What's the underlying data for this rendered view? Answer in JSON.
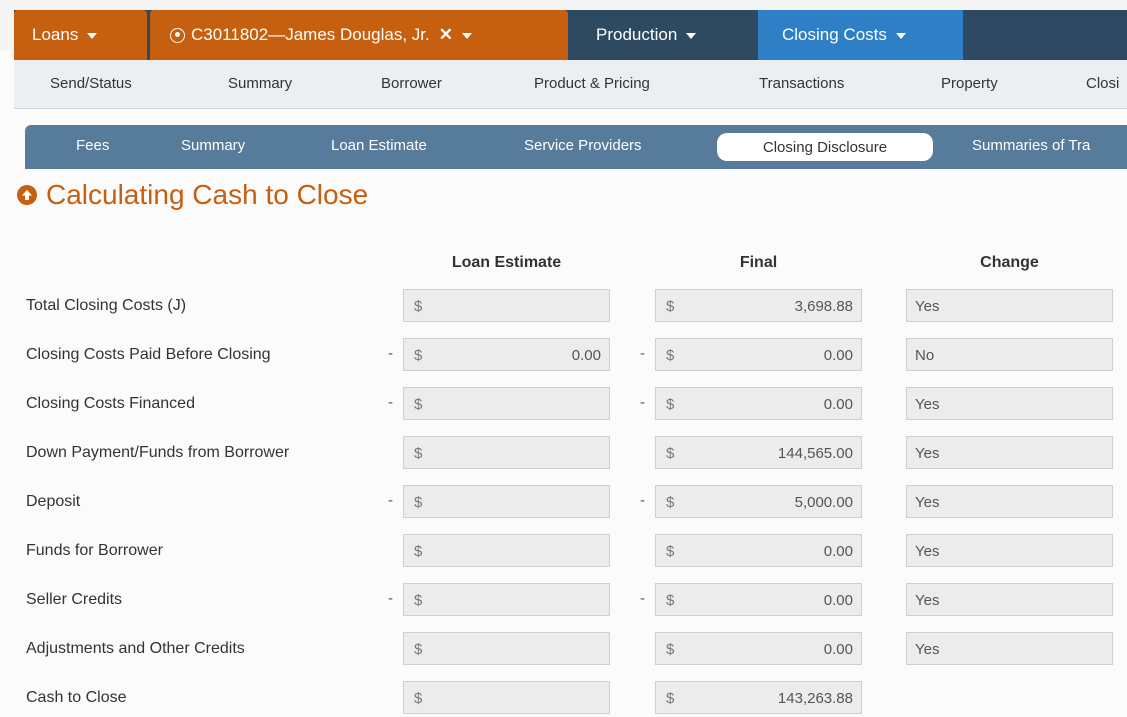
{
  "top_tabs": {
    "loans": "Loans",
    "borrower": "C3011802—James Douglas, Jr.",
    "production": "Production",
    "closing_costs": "Closing Costs"
  },
  "nav2": [
    "Send/Status",
    "Summary",
    "Borrower",
    "Product & Pricing",
    "Transactions",
    "Property",
    "Closi"
  ],
  "nav3": {
    "items": [
      "Fees",
      "Summary",
      "Loan Estimate",
      "Service Providers"
    ],
    "active": "Closing Disclosure",
    "overflow": "Summaries of Tra"
  },
  "heading": "Calculating Cash to Close",
  "columns": {
    "loan_estimate": "Loan Estimate",
    "final": "Final",
    "change": "Change"
  },
  "currency": "$",
  "rows": [
    {
      "label": "Total Closing Costs (J)",
      "minus": false,
      "le": "",
      "final": "3,698.88",
      "change": "Yes"
    },
    {
      "label": "Closing Costs Paid Before Closing",
      "minus": true,
      "le": "0.00",
      "final": "0.00",
      "change": "No"
    },
    {
      "label": "Closing Costs Financed",
      "minus": true,
      "le": "",
      "final": "0.00",
      "change": "Yes"
    },
    {
      "label": "Down Payment/Funds from Borrower",
      "minus": false,
      "le": "",
      "final": "144,565.00",
      "change": "Yes"
    },
    {
      "label": "Deposit",
      "minus": true,
      "le": "",
      "final": "5,000.00",
      "change": "Yes"
    },
    {
      "label": "Funds for Borrower",
      "minus": false,
      "le": "",
      "final": "0.00",
      "change": "Yes"
    },
    {
      "label": "Seller Credits",
      "minus": true,
      "le": "",
      "final": "0.00",
      "change": "Yes"
    },
    {
      "label": "Adjustments and Other Credits",
      "minus": false,
      "le": "",
      "final": "0.00",
      "change": "Yes"
    },
    {
      "label": "Cash to Close",
      "minus": false,
      "le": "",
      "final": "143,263.88",
      "change": null
    }
  ],
  "colors": {
    "orange": "#c65f0f",
    "navy": "#2e4a61",
    "blue": "#2f7fc6",
    "subnav": "#577b9b"
  }
}
